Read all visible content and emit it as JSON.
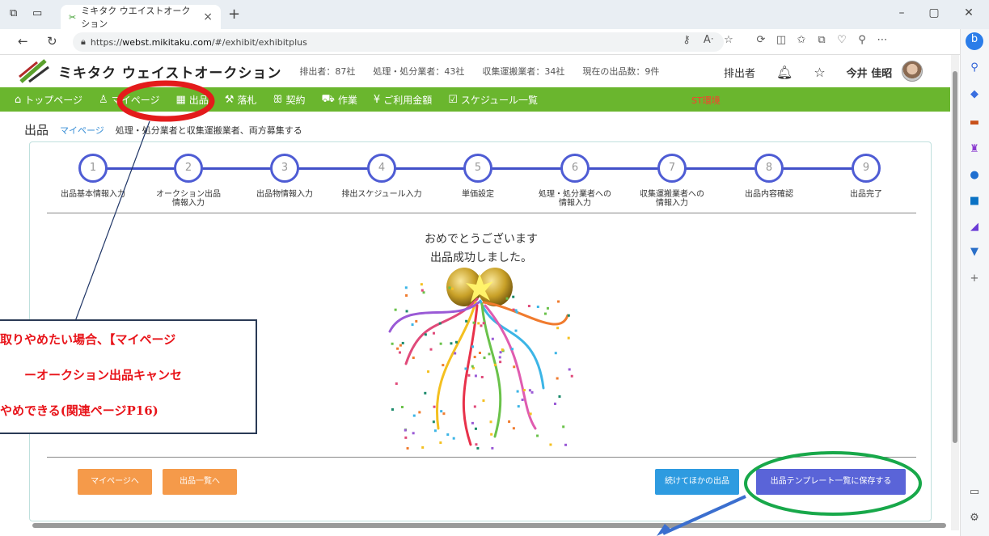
{
  "browser": {
    "tab_title": "ミキタク ウエイストオークション",
    "url_prefix": "https://",
    "url_host": "webst.mikitaku.com",
    "url_path": "/#/exhibit/exhibitplus",
    "window_controls": [
      "–",
      "▢",
      "✕"
    ]
  },
  "header": {
    "logo_icon": "mikitaku-logo",
    "title": "ミキタク ウェイストオークション",
    "stats": [
      "排出者：87社",
      "処理・処分業者：43社",
      "収集運搬業者：34社",
      "現在の出品数：9件"
    ],
    "role": "排出者",
    "user_name": "今井 佳昭"
  },
  "nav": {
    "items": [
      {
        "icon": "home-icon",
        "glyph": "⌂",
        "label": "トップページ"
      },
      {
        "icon": "user-icon",
        "glyph": "♙",
        "label": "マイページ"
      },
      {
        "icon": "boxes-icon",
        "glyph": "▦",
        "label": "出品"
      },
      {
        "icon": "gavel-icon",
        "glyph": "⚒",
        "label": "落札"
      },
      {
        "icon": "handshake-icon",
        "glyph": "ꕥ",
        "label": "契約"
      },
      {
        "icon": "truck-icon",
        "glyph": "⛟",
        "label": "作業"
      },
      {
        "icon": "yen-icon",
        "glyph": "¥",
        "label": "ご利用金額"
      },
      {
        "icon": "calendar-icon",
        "glyph": "☑",
        "label": "スケジュール一覧"
      }
    ],
    "env_label": "ST環境"
  },
  "breadcrumb": {
    "title": "出品",
    "link": "マイページ",
    "current": "処理・処分業者と収集運搬業者、両方募集する"
  },
  "steps": [
    {
      "num": "1",
      "lines": [
        "出品基本情報入力"
      ]
    },
    {
      "num": "2",
      "lines": [
        "オークション出品",
        "情報入力"
      ]
    },
    {
      "num": "3",
      "lines": [
        "出品物情報入力"
      ]
    },
    {
      "num": "4",
      "lines": [
        "排出スケジュール入力"
      ]
    },
    {
      "num": "5",
      "lines": [
        "単価設定"
      ]
    },
    {
      "num": "6",
      "lines": [
        "処理・処分業者への",
        "情報入力"
      ]
    },
    {
      "num": "7",
      "lines": [
        "収集運搬業者への",
        "情報入力"
      ]
    },
    {
      "num": "8",
      "lines": [
        "出品内容確認"
      ]
    },
    {
      "num": "9",
      "lines": [
        "出品完了"
      ]
    }
  ],
  "message": {
    "line1": "おめでとうございます",
    "line2": "出品成功しました。"
  },
  "buttons": {
    "mypage": "マイページへ",
    "list": "出品一覧へ",
    "continue": "続けてほかの出品",
    "save_template": "出品テンプレート一覧に保存する"
  },
  "colors": {
    "nav_green": "#6ab62e",
    "step_blue": "#4e5cd4",
    "orange": "#f59a4a",
    "button_blue": "#2e9be0",
    "button_indigo": "#5a64d8",
    "annotation_red": "#e8141a"
  },
  "annotation": {
    "lines": [
      "取りやめたい場合、【マイページ",
      "ーオークション出品キャンセ",
      "やめできる(関連ページP16)"
    ]
  }
}
